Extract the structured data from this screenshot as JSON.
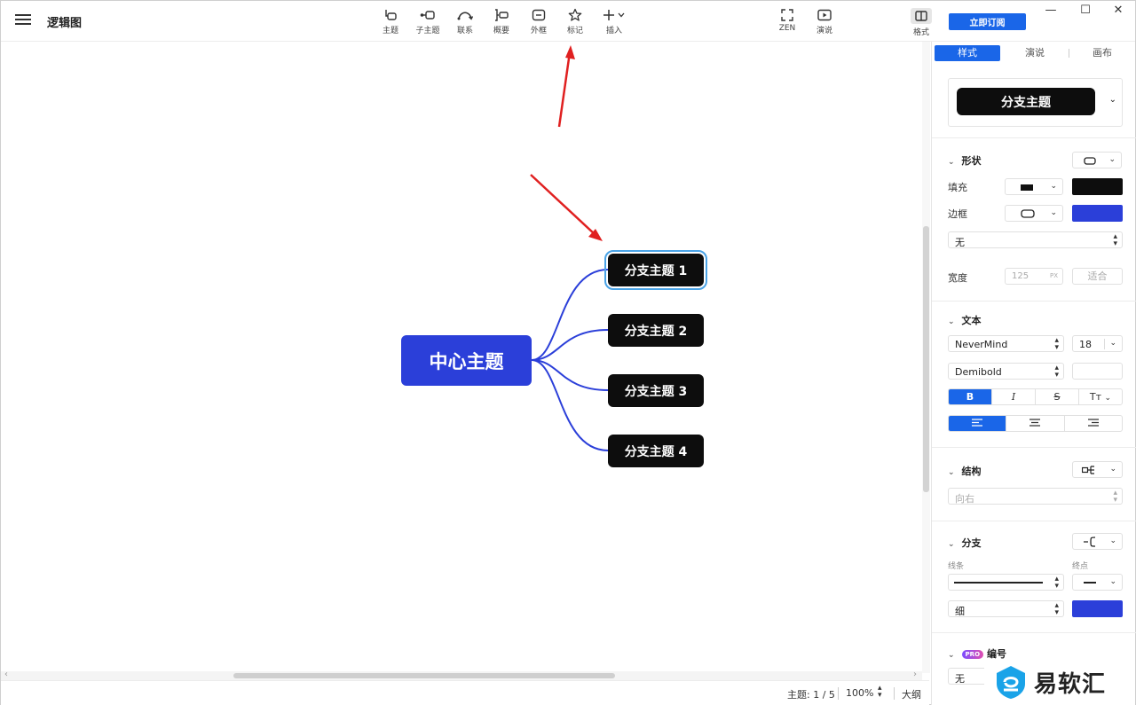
{
  "app": {
    "title": "逻辑图",
    "subscribe_label": "立即订阅",
    "format_label": "格式",
    "window_controls": [
      "—",
      "☐",
      "✕"
    ]
  },
  "toolbar": {
    "items": [
      {
        "label": "主题",
        "icon": "topic-icon"
      },
      {
        "label": "子主题",
        "icon": "subtopic-icon"
      },
      {
        "label": "联系",
        "icon": "relationship-icon"
      },
      {
        "label": "概要",
        "icon": "summary-icon"
      },
      {
        "label": "外框",
        "icon": "boundary-icon"
      },
      {
        "label": "标记",
        "icon": "star-icon"
      },
      {
        "label": "插入",
        "icon": "plus-icon"
      }
    ],
    "zen_label": "ZEN",
    "present_label": "演说"
  },
  "mindmap": {
    "central": "中心主题",
    "branches": [
      "分支主题 1",
      "分支主题 2",
      "分支主题 3",
      "分支主题 4"
    ],
    "selected_index": 0,
    "line_color": "#2b3fd9",
    "central_color": "#2b3fd9",
    "branch_color": "#0d0d0d",
    "annotation_color": "#e02020"
  },
  "status": {
    "topic_count": "主题: 1 / 5",
    "zoom": "100%",
    "outline_label": "大纲"
  },
  "panel": {
    "tabs": [
      "样式",
      "演说",
      "画布"
    ],
    "active_tab": 0,
    "preview_label": "分支主题",
    "shape": {
      "title": "形状",
      "fill_label": "填充",
      "fill_color": "#0d0d0d",
      "border_label": "边框",
      "border_color": "#2b3fd9",
      "border_style": "无",
      "width_label": "宽度",
      "width_value": "125",
      "width_unit": "PX",
      "fit_label": "适合"
    },
    "text": {
      "title": "文本",
      "font": "NeverMind",
      "size": "18",
      "weight": "Demibold",
      "bold": "B",
      "italic": "I",
      "strike": "S",
      "case": "Tт"
    },
    "structure": {
      "title": "结构",
      "direction": "向右"
    },
    "branch": {
      "title": "分支",
      "line_label": "线条",
      "end_label": "终点",
      "thickness": "细",
      "line_color": "#2b3fd9"
    },
    "numbering": {
      "pro_badge": "PRO",
      "title": "编号",
      "value": "无"
    }
  },
  "watermark": {
    "text": "易软汇"
  }
}
